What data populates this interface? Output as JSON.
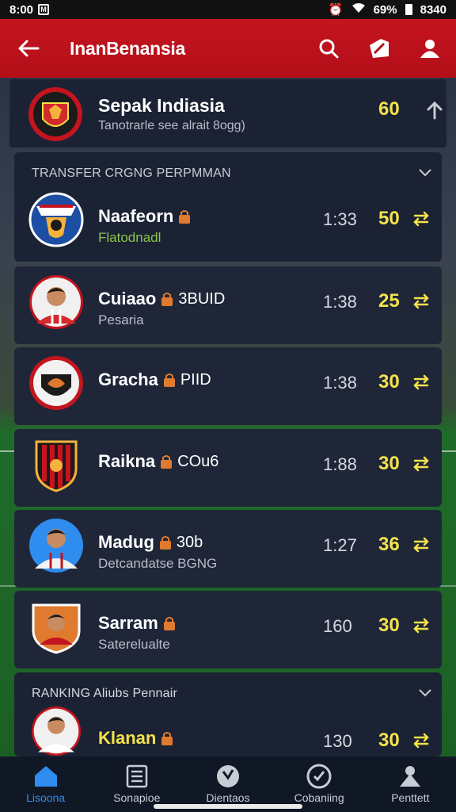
{
  "status_bar": {
    "time": "8:00",
    "battery": "69%",
    "clock_right": "8340"
  },
  "app_bar": {
    "title": "InanBenansia"
  },
  "team_header": {
    "name": "Sepak Indiasia",
    "subtitle": "Tanotrarle see alrait 8ogg)",
    "score": "60"
  },
  "section_transfer": {
    "title": "TRANSFER CRGNG PERPMMAN"
  },
  "section_ranking": {
    "title": "RANKING Aliubs Pennair"
  },
  "rows": [
    {
      "name": "Naafeorn",
      "tag": "",
      "sub": "Flatodnadl",
      "rank": "1:33",
      "points": "50"
    },
    {
      "name": "Cuiaao",
      "tag": "3BUID",
      "sub": "Pesaria",
      "rank": "1:38",
      "points": "25"
    },
    {
      "name": "Gracha",
      "tag": "PIID",
      "sub": "",
      "rank": "1:38",
      "points": "30"
    },
    {
      "name": "Raikna",
      "tag": "COu6",
      "sub": "",
      "rank": "1:88",
      "points": "30"
    },
    {
      "name": "Madug",
      "tag": "30b",
      "sub": "Detcandatse BGNG",
      "rank": "1:27",
      "points": "36"
    },
    {
      "name": "Sarram",
      "tag": "",
      "sub": "Saterelualte",
      "rank": "160",
      "points": "30"
    },
    {
      "name": "Klanan",
      "tag": "",
      "sub": "",
      "rank": "130",
      "points": "30"
    }
  ],
  "bottom_nav": [
    {
      "label": "Lisoona",
      "icon": "home-icon",
      "active": true
    },
    {
      "label": "Sonapioe",
      "icon": "list-icon",
      "active": false
    },
    {
      "label": "Dientaos",
      "icon": "shield-icon",
      "active": false
    },
    {
      "label": "Cobaniing",
      "icon": "badge-icon",
      "active": false
    },
    {
      "label": "Penttett",
      "icon": "person-icon",
      "active": false
    }
  ],
  "colors": {
    "accent_red": "#c4141f",
    "points_yellow": "#f4e24a",
    "active_blue": "#2f8df0",
    "background": "#0d1422"
  }
}
